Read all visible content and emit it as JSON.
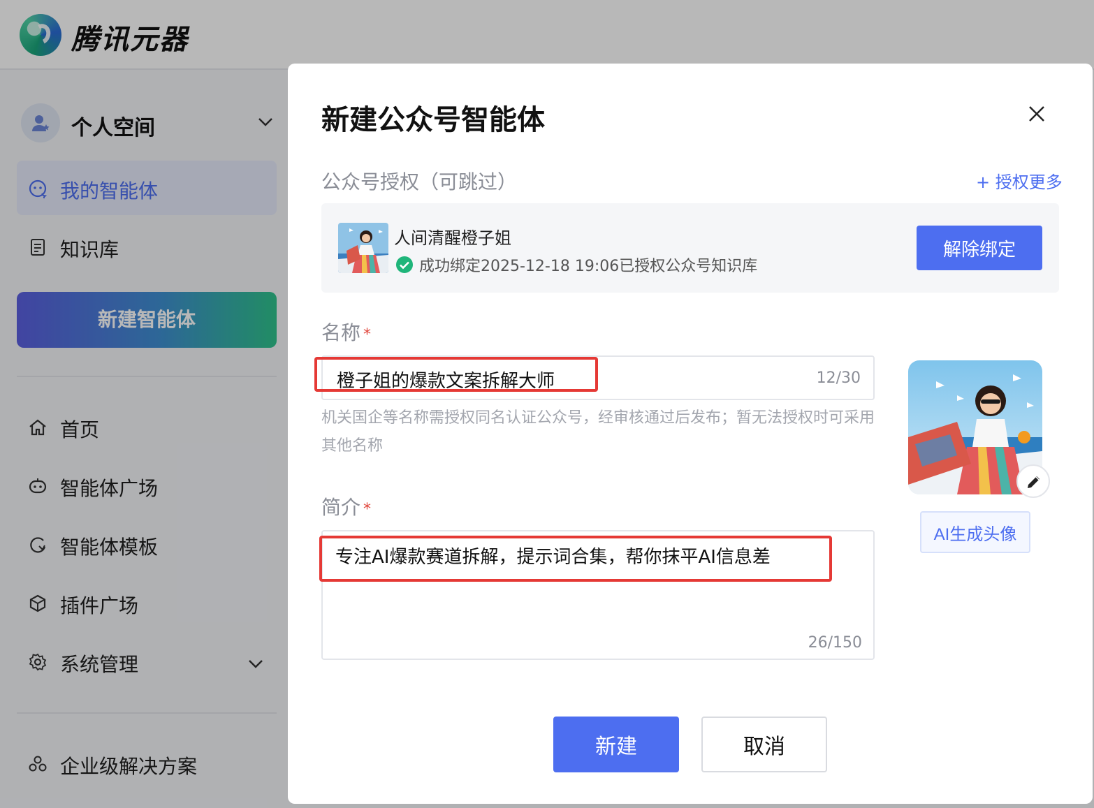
{
  "app": {
    "brand": "腾讯元器",
    "workspace": "个人空间",
    "nav_top": [
      {
        "label": "我的智能体",
        "icon": "agent-icon",
        "active": true
      },
      {
        "label": "知识库",
        "icon": "document-icon",
        "active": false
      }
    ],
    "new_agent_label": "新建智能体",
    "nav_main": [
      {
        "label": "首页",
        "icon": "home-icon"
      },
      {
        "label": "智能体广场",
        "icon": "robot-icon"
      },
      {
        "label": "智能体模板",
        "icon": "template-icon"
      },
      {
        "label": "插件广场",
        "icon": "cube-icon"
      },
      {
        "label": "系统管理",
        "icon": "gear-icon"
      }
    ],
    "nav_bottom": [
      {
        "label": "企业级解决方案",
        "icon": "solution-icon"
      }
    ]
  },
  "modal": {
    "title": "新建公众号智能体",
    "auth_section_title": "公众号授权（可跳过）",
    "auth_more_label": "+ 授权更多",
    "account": {
      "name": "人间清醒橙子姐",
      "status": "成功绑定2025-12-18 19:06已授权公众号知识库"
    },
    "unbind_label": "解除绑定",
    "name_label": "名称",
    "name_value": "橙子姐的爆款文案拆解大师",
    "name_count": "12/30",
    "name_hint": "机关国企等名称需授权同名认证公众号，经审核通过后发布；暂无法授权时可采用其他名称",
    "desc_label": "简介",
    "desc_value": "专注AI爆款赛道拆解，提示词合集，帮你抹平AI信息差",
    "desc_count": "26/150",
    "required_mark": "*",
    "ai_avatar_label": "AI生成头像",
    "create_label": "新建",
    "cancel_label": "取消"
  },
  "colors": {
    "accent": "#4d6ef0",
    "highlight": "#e53935",
    "success": "#1fb57a"
  }
}
